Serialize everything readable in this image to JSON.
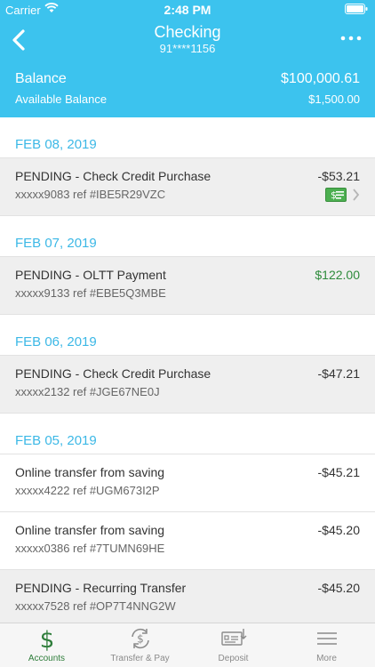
{
  "status_bar": {
    "carrier": "Carrier",
    "time": "2:48 PM"
  },
  "nav": {
    "title": "Checking",
    "account_number": "91****1156"
  },
  "balance": {
    "label": "Balance",
    "value": "$100,000.61",
    "available_label": "Available Balance",
    "available_value": "$1,500.00"
  },
  "colors": {
    "header": "#3cc3ee",
    "date_text": "#3cb8e6",
    "positive_amount": "#2e8b3c",
    "active_tab": "#2e7d3a"
  },
  "groups": [
    {
      "date": "FEB 08, 2019",
      "transactions": [
        {
          "description": "PENDING - Check Credit Purchase",
          "ref": "xxxxx9083 ref #IBE5R29VZC",
          "amount": "-$53.21",
          "pending": true,
          "has_check_image": true
        }
      ]
    },
    {
      "date": "FEB 07, 2019",
      "transactions": [
        {
          "description": "PENDING - OLTT Payment",
          "ref": "xxxxx9133 ref #EBE5Q3MBE",
          "amount": "$122.00",
          "pending": true,
          "positive": true
        }
      ]
    },
    {
      "date": "FEB 06, 2019",
      "transactions": [
        {
          "description": "PENDING - Check Credit Purchase",
          "ref": "xxxxx2132 ref #JGE67NE0J",
          "amount": "-$47.21",
          "pending": true
        }
      ]
    },
    {
      "date": "FEB 05, 2019",
      "transactions": [
        {
          "description": "Online transfer from saving",
          "ref": "xxxxx4222 ref #UGM673I2P",
          "amount": "-$45.21",
          "pending": false
        },
        {
          "description": "Online transfer from saving",
          "ref": "xxxxx0386 ref #7TUMN69HE",
          "amount": "-$45.20",
          "pending": false
        },
        {
          "description": "PENDING - Recurring Transfer",
          "ref": "xxxxx7528 ref #OP7T4NNG2W",
          "amount": "-$45.20",
          "pending": true
        }
      ]
    }
  ],
  "tabs": [
    {
      "label": "Accounts",
      "icon": "dollar-icon",
      "active": true
    },
    {
      "label": "Transfer & Pay",
      "icon": "transfer-icon",
      "active": false
    },
    {
      "label": "Deposit",
      "icon": "deposit-check-icon",
      "active": false
    },
    {
      "label": "More",
      "icon": "menu-icon",
      "active": false
    }
  ]
}
